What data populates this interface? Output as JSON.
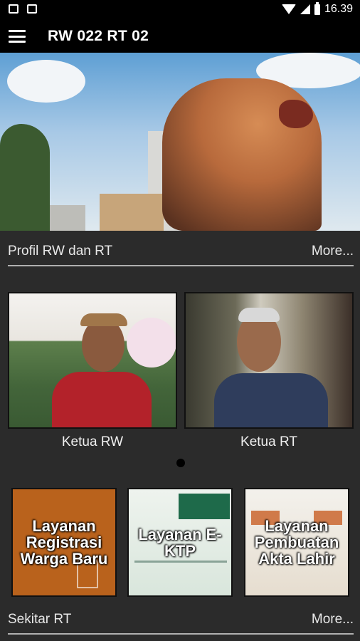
{
  "status_bar": {
    "time": "16.39",
    "icons": [
      "image-icon",
      "android-icon",
      "wifi-icon",
      "signal-icon",
      "battery-icon"
    ]
  },
  "app_bar": {
    "title": "RW 022 RT 02",
    "menu_icon": "hamburger-menu-icon"
  },
  "banner": {
    "image": "tiger-statue-photo",
    "page_indicator": {
      "current": 1,
      "total": 1
    }
  },
  "profile_section": {
    "title": "Profil RW dan RT",
    "more_label": "More...",
    "cards": [
      {
        "label": "Ketua RW",
        "image": "photo-ketua-rw"
      },
      {
        "label": "Ketua RT",
        "image": "photo-ketua-rt"
      }
    ]
  },
  "services": [
    {
      "text": "Layanan Registrasi Warga Baru",
      "color": "#b9621c"
    },
    {
      "text": "Layanan E-KTP",
      "color": "#dfe9e0"
    },
    {
      "text": "Layanan Pembuatan Akta Lahir",
      "color": "#ece6da"
    }
  ],
  "sekitar_section": {
    "title": "Sekitar RT",
    "more_label": "More..."
  },
  "colors": {
    "background": "#2b2b2b",
    "bar": "#000000",
    "divider": "#b0b0b0"
  }
}
